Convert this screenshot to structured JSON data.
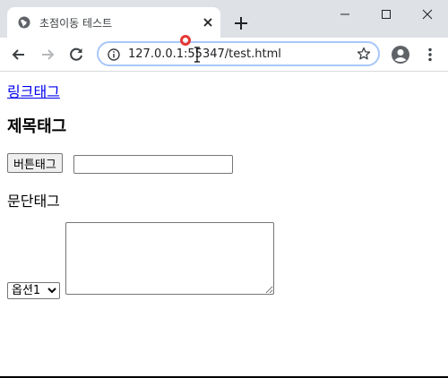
{
  "browser": {
    "tab": {
      "title": "초점이동 테스트",
      "favicon": "globe-icon"
    },
    "address": {
      "url": "127.0.0.1:55347/test.html",
      "info_icon": "info-icon"
    }
  },
  "page": {
    "link_text": "링크태그",
    "heading_text": "제목태그",
    "button_label": "버튼태그",
    "text_input_value": "",
    "paragraph_text": "문단태그",
    "select_selected": "옵션1",
    "textarea_value": ""
  },
  "colors": {
    "titlebar": "#dee1e6",
    "link": "#0000ee",
    "omnibox_focus": "#a8c7fa",
    "cursor_ring": "#e53935"
  }
}
